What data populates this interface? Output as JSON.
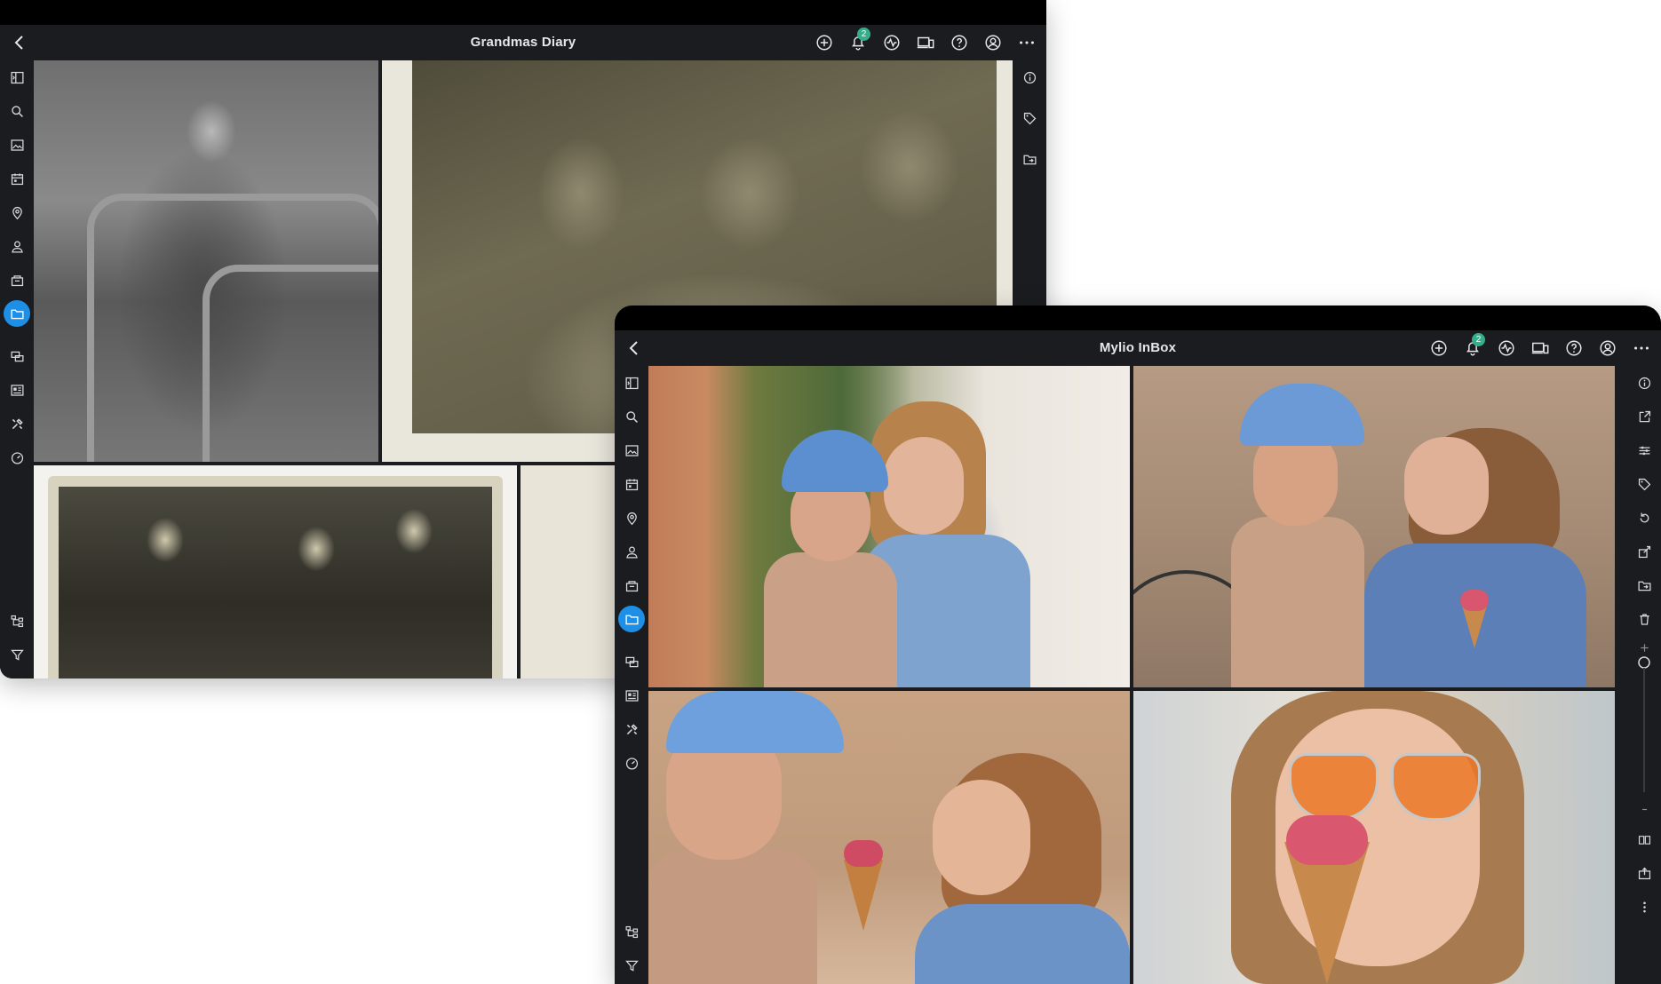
{
  "windows": {
    "back": {
      "title": "Grandmas Diary",
      "notification_count": "2"
    },
    "front": {
      "title": "Mylio InBox",
      "notification_count": "2"
    }
  },
  "icons": {
    "toolbar": [
      "add-icon",
      "bell-icon",
      "activity-icon",
      "devices-icon",
      "help-icon",
      "account-icon",
      "more-icon"
    ],
    "left_sidebar": [
      "panel-toggle-icon",
      "search-icon",
      "photos-icon",
      "calendar-icon",
      "map-pin-icon",
      "person-icon",
      "events-icon",
      "folders-icon",
      "sources-icon",
      "albums-icon",
      "tools-icon",
      "dashboard-icon",
      "hierarchy-icon",
      "filter-icon"
    ],
    "right_sidebar_back": [
      "info-icon",
      "tag-icon",
      "move-to-folder-icon"
    ],
    "right_sidebar_front": [
      "info-icon",
      "share-icon",
      "adjust-icon",
      "tag-icon",
      "rotate-icon",
      "edit-icon",
      "move-to-folder-icon",
      "trash-icon",
      "zoom-in-icon",
      "zoom-slider-icon",
      "zoom-out-icon",
      "book-icon",
      "export-icon",
      "more-vertical-icon"
    ]
  },
  "colors": {
    "chrome": "#1b1c20",
    "active": "#1e8fe6",
    "badge": "#33b08a"
  }
}
